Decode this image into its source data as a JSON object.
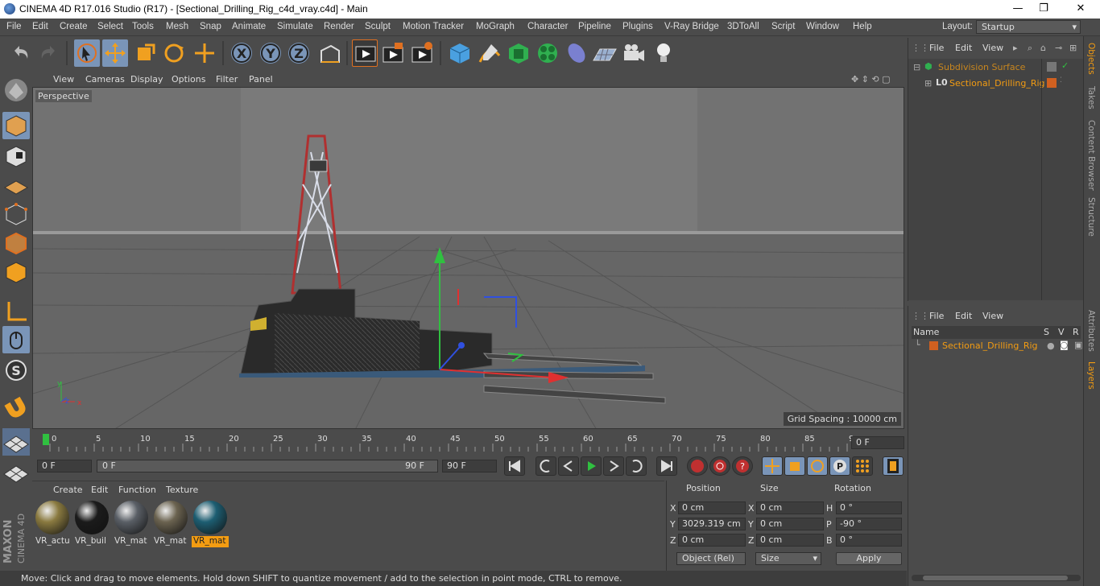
{
  "window": {
    "title": "CINEMA 4D R17.016 Studio (R17) - [Sectional_Drilling_Rig_c4d_vray.c4d] - Main",
    "minimize": "—",
    "maximize": "❐",
    "close": "✕"
  },
  "menu": [
    "File",
    "Edit",
    "Create",
    "Select",
    "Tools",
    "Mesh",
    "Snap",
    "Animate",
    "Simulate",
    "Render",
    "Sculpt",
    "Motion Tracker",
    "MoGraph",
    "Character",
    "Pipeline",
    "Plugins",
    "V-Ray Bridge",
    "3DToAll",
    "Script",
    "Window",
    "Help"
  ],
  "layout": {
    "label": "Layout:",
    "value": "Startup"
  },
  "viewport": {
    "menu": [
      "View",
      "Cameras",
      "Display",
      "Options",
      "Filter",
      "Panel"
    ],
    "camera_label": "Perspective",
    "grid_spacing": "Grid Spacing : 10000 cm"
  },
  "timeline": {
    "ticks": [
      "0",
      "5",
      "10",
      "15",
      "20",
      "25",
      "30",
      "35",
      "40",
      "45",
      "50",
      "55",
      "60",
      "65",
      "70",
      "75",
      "80",
      "85",
      "90"
    ],
    "current_frame": "0 F"
  },
  "playback": {
    "start": "0 F",
    "range_start": "0 F",
    "range_end": "90 F",
    "end": "90 F"
  },
  "material_manager": {
    "menu": [
      "Create",
      "Edit",
      "Function",
      "Texture"
    ],
    "materials": [
      {
        "name": "VR_actu",
        "color": "#8a7a40"
      },
      {
        "name": "VR_buil",
        "color": "#1b1b1b"
      },
      {
        "name": "VR_mat",
        "color": "#5a5f66"
      },
      {
        "name": "VR_mat",
        "color": "#6b6350"
      },
      {
        "name": "VR_mat",
        "color": "#1d5e72",
        "selected": true
      }
    ]
  },
  "coordinates": {
    "headers": [
      "Position",
      "Size",
      "Rotation"
    ],
    "position": {
      "x": "0 cm",
      "y": "3029.319 cm",
      "z": "0 cm"
    },
    "size": {
      "x": "0 cm",
      "y": "0 cm",
      "z": "0 cm"
    },
    "rotation": {
      "h": "0 °",
      "p": "-90 °",
      "b": "0 °"
    },
    "axis_labels": {
      "x": "X",
      "y": "Y",
      "z": "Z",
      "h": "H",
      "p": "P",
      "b": "B"
    },
    "mode": "Object (Rel)",
    "size_mode": "Size",
    "apply": "Apply"
  },
  "status": "Move: Click and drag to move elements. Hold down SHIFT to quantize movement / add to the selection in point mode, CTRL to remove.",
  "object_manager": {
    "menu": [
      "File",
      "Edit",
      "View"
    ],
    "objects": [
      "Subdivision Surface",
      "Sectional_Drilling_Rig"
    ]
  },
  "layer_manager": {
    "menu": [
      "File",
      "Edit",
      "View"
    ],
    "columns": [
      "Name",
      "S",
      "V",
      "R"
    ],
    "layers": [
      "Sectional_Drilling_Rig"
    ]
  },
  "side_tabs": [
    "Objects",
    "Takes",
    "Content Browser",
    "Structure",
    "Attributes",
    "Layers"
  ],
  "branding": {
    "maxon": "MAXON",
    "product": "CINEMA 4D"
  },
  "axis_gizmo": {
    "y": "y",
    "z": "z",
    "x": "x"
  }
}
